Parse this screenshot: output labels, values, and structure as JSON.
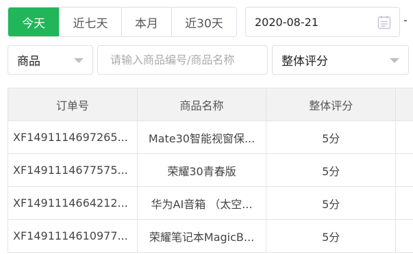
{
  "date_tabs": [
    {
      "label": "今天",
      "active": true
    },
    {
      "label": "近七天",
      "active": false
    },
    {
      "label": "本月",
      "active": false
    },
    {
      "label": "近30天",
      "active": false
    }
  ],
  "date_picker": {
    "value": "2020-08-21",
    "separator": "-",
    "icon": "calendar-icon"
  },
  "filters": {
    "field_select": "商品",
    "search_placeholder": "请输入商品编号/商品名称",
    "rating_select": "整体评分",
    "caret_icon": "chevron-down-icon"
  },
  "table": {
    "columns": [
      "订单号",
      "商品名称",
      "整体评分",
      ""
    ],
    "rows": [
      {
        "order_no": "XF1491114697265...",
        "product": "Mate30智能视窗保...",
        "rating": "5分"
      },
      {
        "order_no": "XF1491114677575...",
        "product": "荣耀30青春版",
        "rating": "5分"
      },
      {
        "order_no": "XF1491114664212...",
        "product": "华为AI音箱 （太空...",
        "rating": "5分"
      },
      {
        "order_no": "XF1491114610977...",
        "product": "荣耀笔记本MagicB...",
        "rating": "5分"
      }
    ]
  },
  "colors": {
    "accent": "#21b65a",
    "header_bg": "#f2f2f2",
    "border": "#dcdfe6"
  }
}
